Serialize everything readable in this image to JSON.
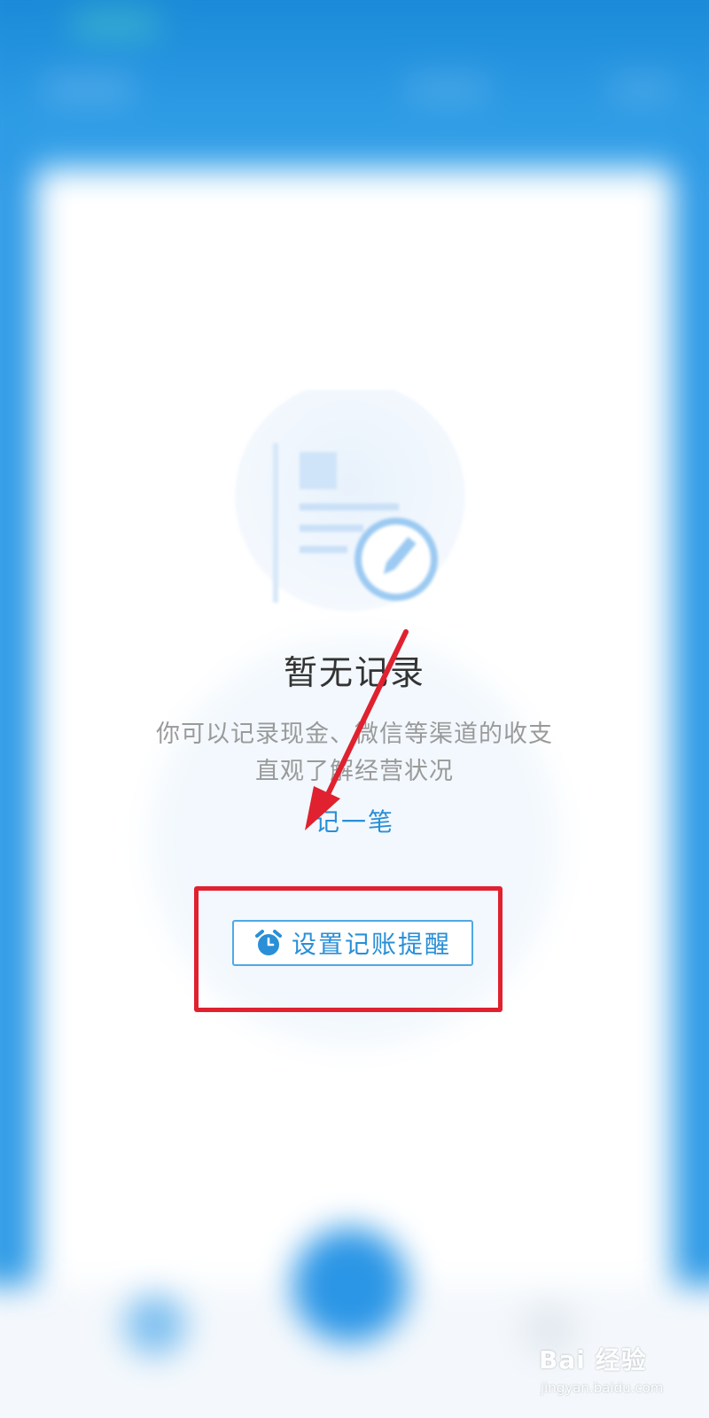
{
  "empty_state": {
    "title": "暂无记录",
    "description_line1": "你可以记录现金、微信等渠道的收支",
    "description_line2": "直观了解经营状况",
    "record_link": "记一笔"
  },
  "reminder": {
    "label": "设置记账提醒",
    "icon": "alarm-clock-icon"
  },
  "illustration": {
    "icon": "document-edit-icon"
  },
  "annotations": {
    "highlight_color": "#e0212f",
    "arrow_color": "#e0212f"
  },
  "watermark": {
    "brand": "Bai 经验",
    "url": "jingyan.baidu.com"
  },
  "colors": {
    "primary_blue": "#2a98e3",
    "link_blue": "#2a8fd6",
    "title_text": "#333333",
    "desc_text": "#9a9a9a"
  }
}
